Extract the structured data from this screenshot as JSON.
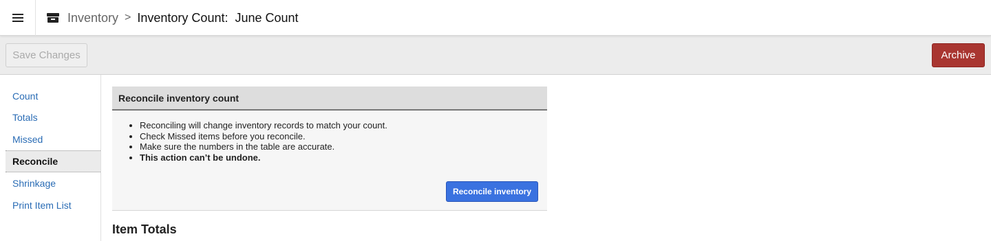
{
  "header": {
    "breadcrumb_root": "Inventory",
    "breadcrumb_separator": ">",
    "breadcrumb_current": "Inventory Count:  June Count"
  },
  "toolbar": {
    "save_label": "Save Changes",
    "archive_label": "Archive"
  },
  "sidebar": {
    "items": [
      {
        "label": "Count"
      },
      {
        "label": "Totals"
      },
      {
        "label": "Missed"
      },
      {
        "label": "Reconcile",
        "active": true
      },
      {
        "label": "Shrinkage"
      },
      {
        "label": "Print Item List"
      }
    ]
  },
  "panel": {
    "title": "Reconcile inventory count",
    "bullets": [
      "Reconciling will change inventory records to match your count.",
      "Check Missed items before you reconcile.",
      "Make sure the numbers in the table are accurate.",
      "This action can’t be undone."
    ],
    "button_label": "Reconcile inventory"
  },
  "section": {
    "title": "Item Totals"
  },
  "colors": {
    "archive": "#a93631",
    "reconcile": "#3a72e0",
    "link": "#2a6cb5"
  }
}
